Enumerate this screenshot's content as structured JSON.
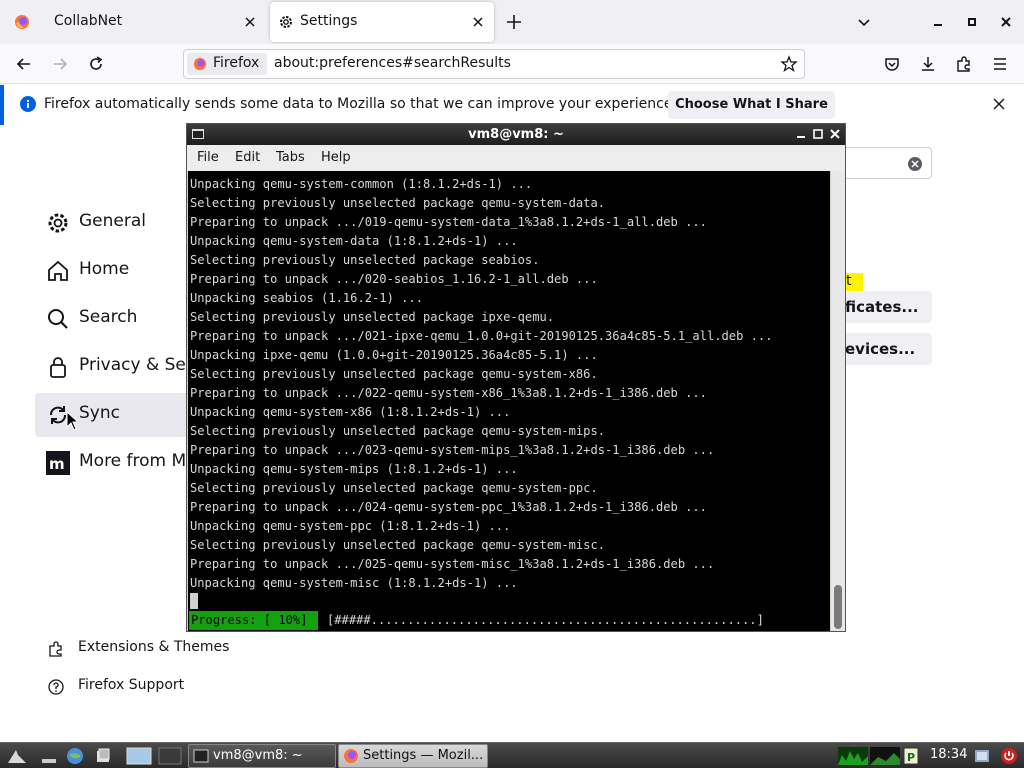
{
  "browser": {
    "tabs": [
      {
        "label": "CollabNet",
        "active": false
      },
      {
        "label": "Settings",
        "active": true
      }
    ],
    "identity_label": "Firefox",
    "url": "about:preferences#searchResults"
  },
  "notification": {
    "message": "Firefox automatically sends some data to Mozilla so that we can improve your experience.",
    "button_label": "Choose What I Share"
  },
  "settings": {
    "categories": [
      {
        "label": "General",
        "icon": "gear-icon"
      },
      {
        "label": "Home",
        "icon": "home-icon"
      },
      {
        "label": "Search",
        "icon": "search-icon"
      },
      {
        "label": "Privacy & Sec",
        "icon": "lock-icon"
      },
      {
        "label": "Sync",
        "icon": "sync-icon",
        "active": true
      },
      {
        "label": "More from Mo",
        "icon": "mozilla-icon"
      }
    ],
    "footer": [
      {
        "label": "Extensions & Themes",
        "icon": "puzzle-icon"
      },
      {
        "label": "Firefox Support",
        "icon": "help-icon"
      }
    ],
    "highlight_fragment": "t",
    "partial_buttons": [
      "ficates...",
      "evices..."
    ]
  },
  "terminal": {
    "title": "vm8@vm8: ~",
    "menu": [
      "File",
      "Edit",
      "Tabs",
      "Help"
    ],
    "lines": [
      "Unpacking qemu-system-common (1:8.1.2+ds-1) ...",
      "Selecting previously unselected package qemu-system-data.",
      "Preparing to unpack .../019-qemu-system-data_1%3a8.1.2+ds-1_all.deb ...",
      "Unpacking qemu-system-data (1:8.1.2+ds-1) ...",
      "Selecting previously unselected package seabios.",
      "Preparing to unpack .../020-seabios_1.16.2-1_all.deb ...",
      "Unpacking seabios (1.16.2-1) ...",
      "Selecting previously unselected package ipxe-qemu.",
      "Preparing to unpack .../021-ipxe-qemu_1.0.0+git-20190125.36a4c85-5.1_all.deb ...",
      "Unpacking ipxe-qemu (1.0.0+git-20190125.36a4c85-5.1) ...",
      "Selecting previously unselected package qemu-system-x86.",
      "Preparing to unpack .../022-qemu-system-x86_1%3a8.1.2+ds-1_i386.deb ...",
      "Unpacking qemu-system-x86 (1:8.1.2+ds-1) ...",
      "Selecting previously unselected package qemu-system-mips.",
      "Preparing to unpack .../023-qemu-system-mips_1%3a8.1.2+ds-1_i386.deb ...",
      "Unpacking qemu-system-mips (1:8.1.2+ds-1) ...",
      "Selecting previously unselected package qemu-system-ppc.",
      "Preparing to unpack .../024-qemu-system-ppc_1%3a8.1.2+ds-1_i386.deb ...",
      "Unpacking qemu-system-ppc (1:8.1.2+ds-1) ...",
      "Selecting previously unselected package qemu-system-misc.",
      "Preparing to unpack .../025-qemu-system-misc_1%3a8.1.2+ds-1_i386.deb ...",
      "Unpacking qemu-system-misc (1:8.1.2+ds-1) ..."
    ],
    "progress_label": "Progress: [ 10%]",
    "progress_bar": "[#####.....................................................]",
    "progress_fraction": 0.1
  },
  "taskbar": {
    "tasks": [
      {
        "label": "vm8@vm8: ~",
        "active": false
      },
      {
        "label": "Settings — Mozil...",
        "active": true
      }
    ],
    "clock": "18:34"
  },
  "colors": {
    "accent": "#0060df",
    "progress_green": "#13a10e",
    "search_highlight": "#fff400",
    "terminal_bg": "#000000"
  }
}
